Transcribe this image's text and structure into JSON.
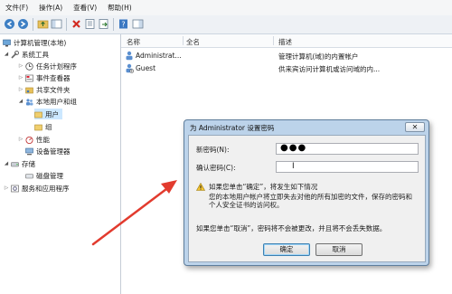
{
  "menu": [
    "文件(F)",
    "操作(A)",
    "查看(V)",
    "帮助(H)"
  ],
  "toolbar_icons": [
    "back-arrow-icon",
    "forward-arrow-icon",
    "up-folder-icon",
    "show-tree-icon",
    "delete-icon",
    "properties-icon",
    "export-icon",
    "help-icon",
    "show-action-pane-icon"
  ],
  "tree": {
    "root": "计算机管理(本地)",
    "system_tools": "系统工具",
    "task_scheduler": "任务计划程序",
    "event_viewer": "事件查看器",
    "shared_folders": "共享文件夹",
    "local_users_groups": "本地用户和组",
    "users": "用户",
    "groups": "组",
    "performance": "性能",
    "device_manager": "设备管理器",
    "storage": "存储",
    "disk_management": "磁盘管理",
    "services_apps": "服务和应用程序"
  },
  "list": {
    "columns": {
      "name": "名称",
      "fullname": "全名",
      "description": "描述"
    },
    "rows": [
      {
        "name": "Administrat...",
        "fullname": "",
        "description": "管理计算机(域)的内置帐户"
      },
      {
        "name": "Guest",
        "fullname": "",
        "description": "供来宾访问计算机或访问域的内..."
      }
    ]
  },
  "dialog": {
    "title": "为 Administrator 设置密码",
    "close_glyph": "✕",
    "new_password_label": "新密码(N):",
    "new_password_value": "●●●",
    "confirm_label": "确认密码(C):",
    "confirm_value": "",
    "cursor_glyph": "I",
    "warning_line1": "如果您单击“确定”，将发生如下情况",
    "warning_body": "您的本地用户帐户将立即失去对他的所有加密的文件，保存的密码和个人安全证书的访问权。",
    "cancel_note": "如果您单击“取消”，密码将不会被更改，并且将不会丢失数据。",
    "ok_label": "确定",
    "cancel_label": "取消"
  },
  "colors": {
    "annotation_arrow": "#e23b2e",
    "dialog_frame": "#bcd3ea",
    "selection": "#cce8ff"
  }
}
